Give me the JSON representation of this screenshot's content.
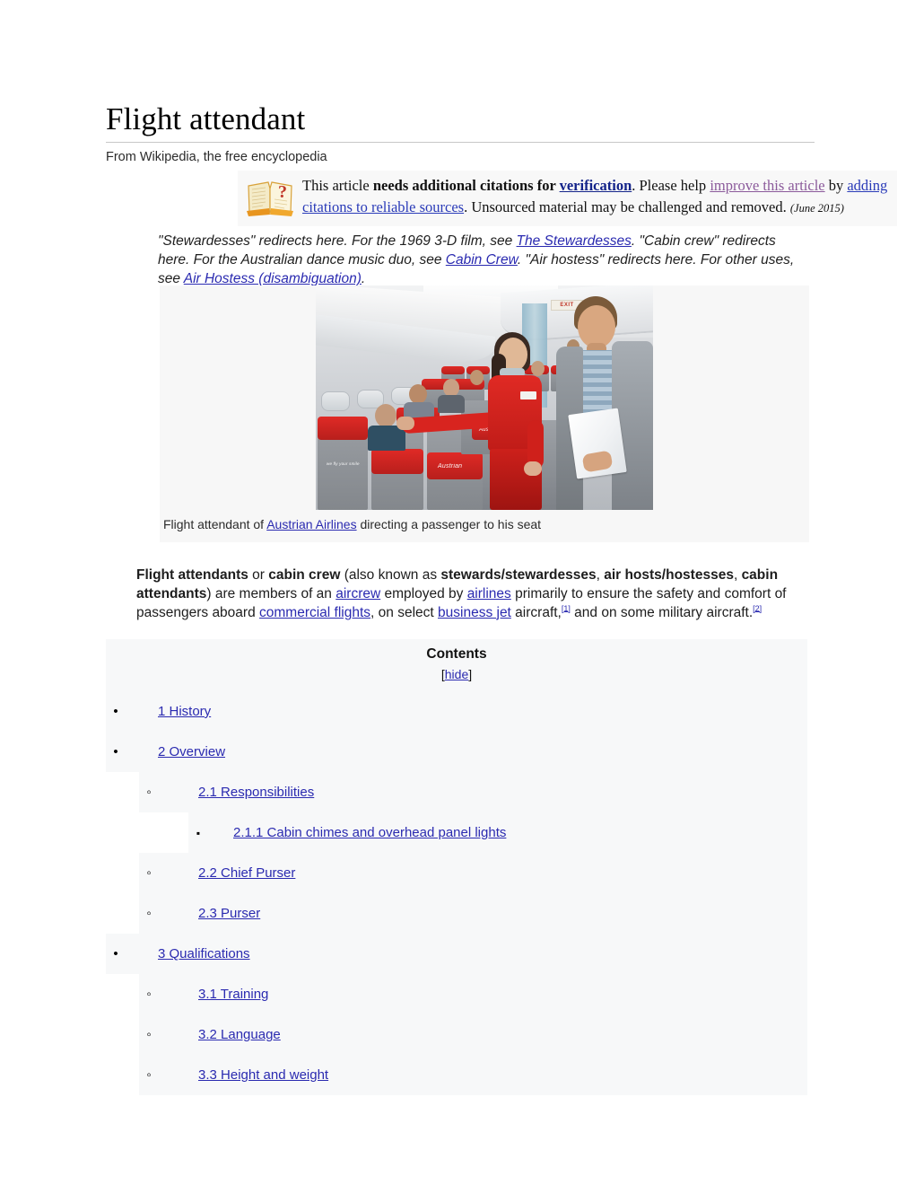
{
  "article": {
    "title": "Flight attendant",
    "tagline": "From Wikipedia, the free encyclopedia"
  },
  "maintenance_notice": {
    "icon": "book-question-icon",
    "text_1": "This article ",
    "bold_1": "needs additional citations for ",
    "link_verification": "verification",
    "text_2": ". Please help ",
    "link_improve": "improve this article",
    "text_3": " by ",
    "link_sources": "adding citations to reliable sources",
    "text_4": ". Unsourced material may be challenged and removed. ",
    "date": "(June 2015)"
  },
  "hatnote": {
    "part_1": "\"Stewardesses\" redirects here. For the 1969 3-D film, see ",
    "link_1": "The Stewardesses",
    "part_2": ". \"Cabin crew\" redirects here. For the Australian dance music duo, see ",
    "link_2": "Cabin Crew",
    "part_3": ". \"Air hostess\" redirects here. For other uses, see ",
    "link_3": "Air Hostess (disambiguation)",
    "part_4": "."
  },
  "thumbnail": {
    "alt": "Flight attendant of Austrian Airlines directing a passenger to his seat",
    "caption_part_1": "Flight attendant of ",
    "caption_link": "Austrian Airlines",
    "caption_part_2": " directing a passenger to his seat",
    "exit_sign": "EXIT",
    "seat_logo": "Austrian",
    "seat_logo_small": "we fly your smile"
  },
  "lead": {
    "bold_1": "Flight attendants",
    "t1": " or ",
    "bold_2": "cabin crew",
    "t2": " (also known as ",
    "bold_3": "stewards/stewardesses",
    "t3": ", ",
    "bold_4": "air hosts/hostesses",
    "t4": ", ",
    "bold_5": "cabin attendants",
    "t5": ") are members of an ",
    "link_aircrew": "aircrew",
    "t6": " employed by ",
    "link_airlines": "airlines",
    "t7": " primarily to ensure the safety and comfort of passengers aboard ",
    "link_commercial": "commercial flights",
    "t8": ", on select ",
    "link_business_jet": "business jet",
    "t9": " aircraft,",
    "ref_1": "[1]",
    "t10": " and on some military aircraft.",
    "ref_2": "[2]"
  },
  "toc": {
    "title": "Contents",
    "toggle_open_bracket": "[",
    "toggle_label": "hide",
    "toggle_close_bracket": "]",
    "items": [
      {
        "level": 1,
        "label": "1 History"
      },
      {
        "level": 1,
        "label": "2 Overview"
      },
      {
        "level": 2,
        "label": "2.1 Responsibilities"
      },
      {
        "level": 3,
        "label": "2.1.1 Cabin chimes and overhead panel lights"
      },
      {
        "level": 2,
        "label": "2.2 Chief Purser"
      },
      {
        "level": 2,
        "label": "2.3 Purser"
      },
      {
        "level": 1,
        "label": "3 Qualifications"
      },
      {
        "level": 2,
        "label": "3.1 Training"
      },
      {
        "level": 2,
        "label": "3.2 Language"
      },
      {
        "level": 2,
        "label": "3.3 Height and weight"
      }
    ]
  },
  "colors": {
    "link": "#2a2ab0",
    "link_visited": "#8b5a9b",
    "toc_background": "#f7f8f9",
    "notice_background": "#f8f8f8",
    "uniform_red": "#d8241f"
  }
}
